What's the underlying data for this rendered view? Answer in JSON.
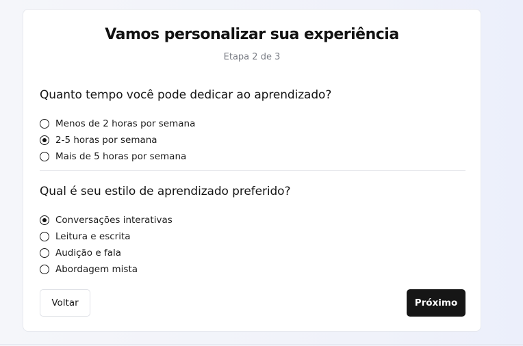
{
  "header": {
    "title": "Vamos personalizar sua experiência",
    "step": "Etapa 2 de 3"
  },
  "questions": [
    {
      "text": "Quanto tempo você pode dedicar ao aprendizado?",
      "options": [
        {
          "label": "Menos de 2 horas por semana",
          "selected": false
        },
        {
          "label": "2-5 horas por semana",
          "selected": true
        },
        {
          "label": "Mais de 5 horas por semana",
          "selected": false
        }
      ]
    },
    {
      "text": "Qual é seu estilo de aprendizado preferido?",
      "options": [
        {
          "label": "Conversações interativas",
          "selected": true
        },
        {
          "label": "Leitura e escrita",
          "selected": false
        },
        {
          "label": "Audição e fala",
          "selected": false
        },
        {
          "label": "Abordagem mista",
          "selected": false
        }
      ]
    }
  ],
  "actions": {
    "back_label": "Voltar",
    "next_label": "Próximo"
  },
  "colors": {
    "primary_button": "#161616",
    "background": "#f0f2fa",
    "muted_text": "#7a7d85"
  }
}
